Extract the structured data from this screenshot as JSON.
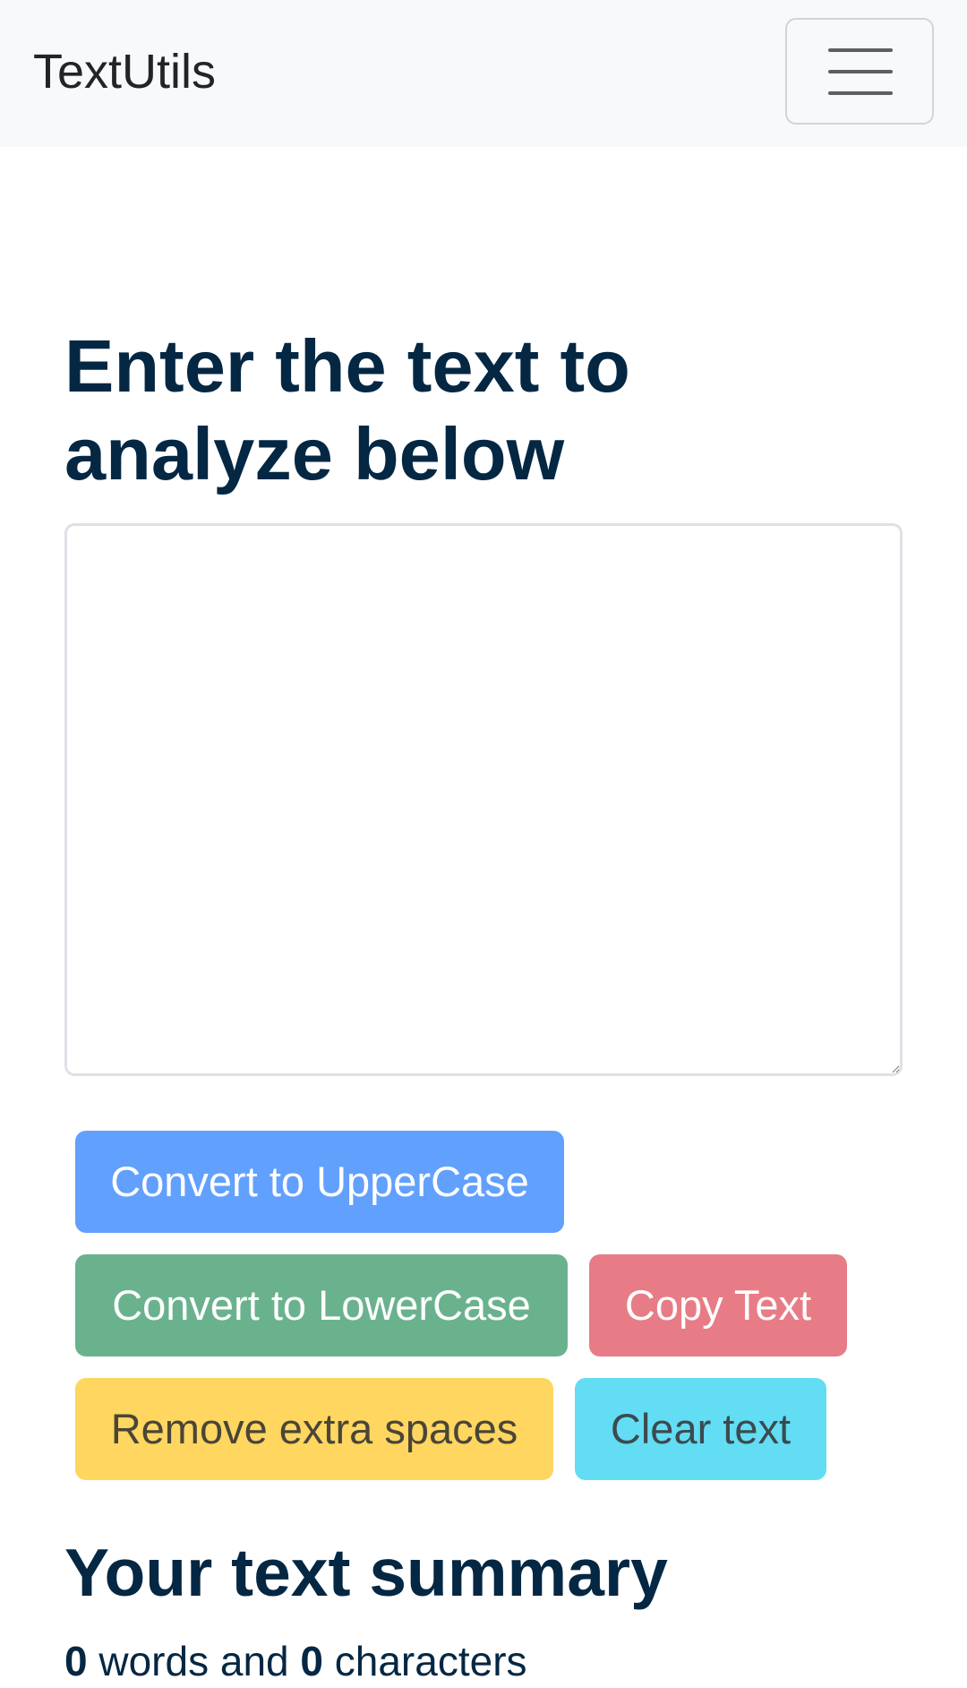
{
  "navbar": {
    "brand": "TextUtils",
    "toggler_icon": "hamburger-menu-icon"
  },
  "main": {
    "heading": "Enter the text to analyze below",
    "textarea_value": ""
  },
  "buttons": {
    "uppercase": "Convert to UpperCase",
    "lowercase": "Convert to LowerCase",
    "copy": "Copy Text",
    "remove_spaces": "Remove extra spaces",
    "clear": "Clear text"
  },
  "summary": {
    "heading": "Your text summary",
    "word_count": "0",
    "words_label": "words and",
    "char_count": "0",
    "chars_label": "characters"
  },
  "colors": {
    "heading_text": "#042743",
    "uppercase_button": "#62a0fe",
    "lowercase_button": "#6ab28e",
    "copy_button": "#e77c86",
    "remove_spaces_button": "#fed660",
    "clear_button": "#62ddf3",
    "navbar_background": "#f8f9fa"
  }
}
